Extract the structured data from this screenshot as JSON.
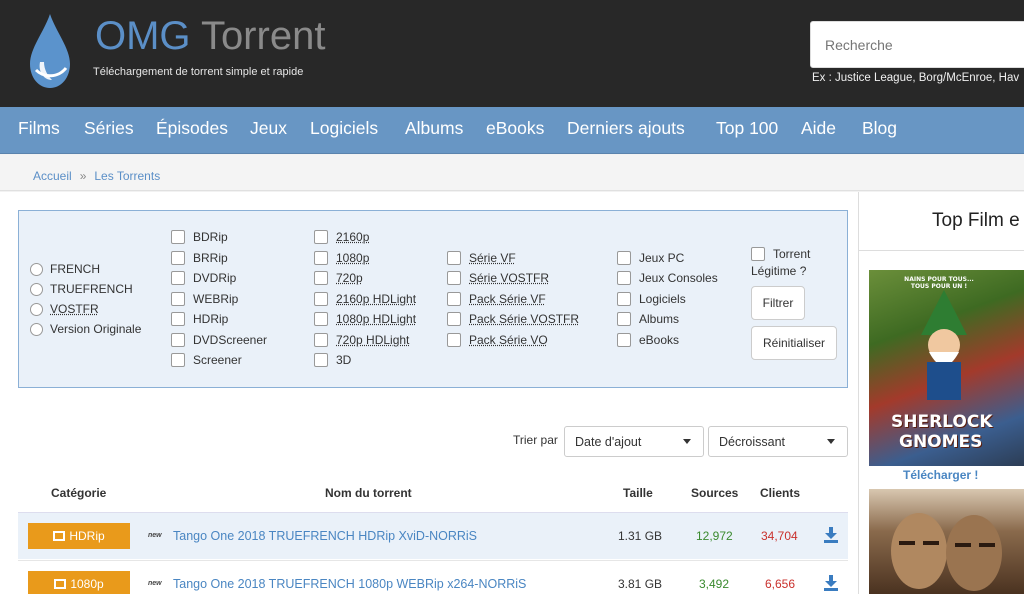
{
  "header": {
    "logo_omg": "OMG",
    "logo_torrent": "Torrent",
    "tagline": "Téléchargement de torrent simple et rapide",
    "search_placeholder": "Recherche",
    "search_hint": "Ex : Justice League, Borg/McEnroe, Hav"
  },
  "nav": [
    "Films",
    "Séries",
    "Épisodes",
    "Jeux",
    "Logiciels",
    "Albums",
    "eBooks",
    "Derniers ajouts",
    "Top 100",
    "Aide",
    "Blog"
  ],
  "breadcrumb": {
    "home": "Accueil",
    "sep": "»",
    "current": "Les Torrents"
  },
  "filters": {
    "languages": [
      "FRENCH",
      "TRUEFRENCH",
      "VOSTFR",
      "Version Originale"
    ],
    "qualities_col1": [
      "BDRip",
      "BRRip",
      "DVDRip",
      "WEBRip",
      "HDRip",
      "DVDScreener",
      "Screener"
    ],
    "qualities_col2": [
      "2160p",
      "1080p",
      "720p",
      "2160p HDLight",
      "1080p HDLight",
      "720p HDLight",
      "3D"
    ],
    "series": [
      "Série VF",
      "Série VOSTFR",
      "Pack Série VF",
      "Pack Série VOSTFR",
      "Pack Série VO"
    ],
    "others": [
      "Jeux PC",
      "Jeux Consoles",
      "Logiciels",
      "Albums",
      "eBooks"
    ],
    "legit_line1": "Torrent",
    "legit_line2": "Légitime ?",
    "filter_button": "Filtrer",
    "reset_button": "Réinitialiser"
  },
  "sort": {
    "label": "Trier par",
    "field": "Date d'ajout",
    "order": "Décroissant"
  },
  "table": {
    "headers": {
      "category": "Catégorie",
      "name": "Nom du torrent",
      "size": "Taille",
      "sources": "Sources",
      "clients": "Clients"
    },
    "rows": [
      {
        "category": "HDRip",
        "new": "new",
        "name": "Tango One 2018 TRUEFRENCH HDRip XviD-NORRiS",
        "size": "1.31 GB",
        "sources": "12,972",
        "clients": "34,704"
      },
      {
        "category": "1080p",
        "new": "new",
        "name": "Tango One 2018 TRUEFRENCH 1080p WEBRip x264-NORRiS",
        "size": "3.81 GB",
        "sources": "3,492",
        "clients": "6,656"
      }
    ]
  },
  "sidebar": {
    "title": "Top Film e",
    "poster1_tag": "NAINS POUR TOUS... TOUS POUR UN !",
    "poster1_title_1": "SHERLOCK",
    "poster1_title_2": "GNOMES",
    "download_link": "Télécharger !"
  },
  "colors": {
    "header_bg": "#282828",
    "nav_bg": "#6896c4",
    "accent_blue": "#4a86c2",
    "badge_orange": "#e99a1b",
    "sources_green": "#3a8a2e",
    "clients_red": "#c9302c"
  }
}
